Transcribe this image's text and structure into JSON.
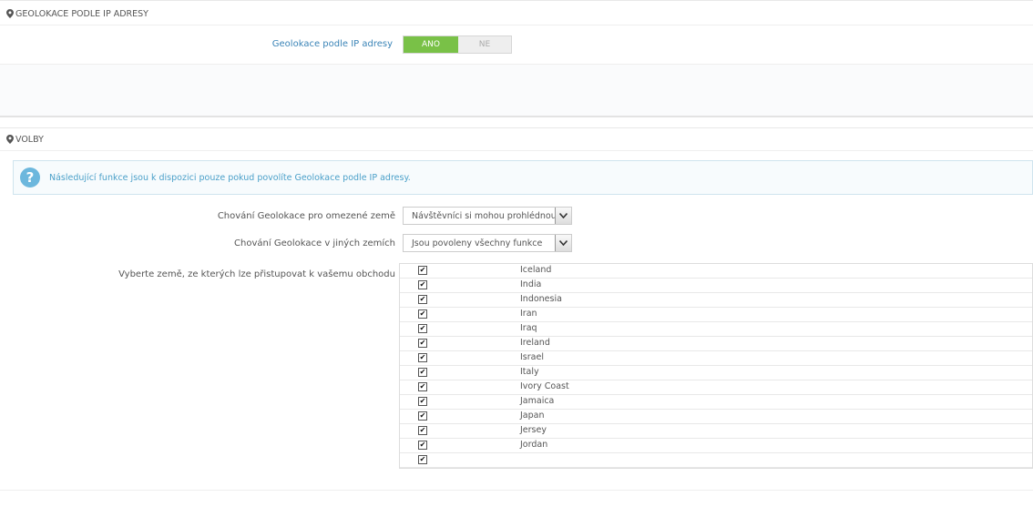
{
  "geo_section": {
    "title": "GEOLOKACE PODLE IP ADRESY",
    "toggle_label": "Geolokace podle IP adresy",
    "toggle_on": "ANO",
    "toggle_off": "NE",
    "toggle_value": "ANO"
  },
  "options_section": {
    "title": "VOLBY",
    "info_text": "Následující funkce jsou k dispozici pouze pokud povolíte Geolokace podle IP adresy.",
    "restricted_label": "Chování Geolokace pro omezené země",
    "restricted_value": "Návštěvníci si mohou prohlédnout i",
    "other_label": "Chování Geolokace v jiných zemích",
    "other_value": "Jsou povoleny všechny funkce",
    "countries_label": "Vyberte země, ze kterých lze přistupovat k vašemu obchodu",
    "countries": [
      {
        "name": "Iceland",
        "checked": true
      },
      {
        "name": "India",
        "checked": true
      },
      {
        "name": "Indonesia",
        "checked": true
      },
      {
        "name": "Iran",
        "checked": true
      },
      {
        "name": "Iraq",
        "checked": true
      },
      {
        "name": "Ireland",
        "checked": true
      },
      {
        "name": "Israel",
        "checked": true
      },
      {
        "name": "Italy",
        "checked": true
      },
      {
        "name": "Ivory Coast",
        "checked": true
      },
      {
        "name": "Jamaica",
        "checked": true
      },
      {
        "name": "Japan",
        "checked": true
      },
      {
        "name": "Jersey",
        "checked": true
      },
      {
        "name": "Jordan",
        "checked": true
      },
      {
        "name": "",
        "checked": true
      }
    ]
  },
  "colors": {
    "accent_green": "#79c147",
    "info_blue": "#4ba0c9",
    "label_blue": "#3a84b7"
  }
}
